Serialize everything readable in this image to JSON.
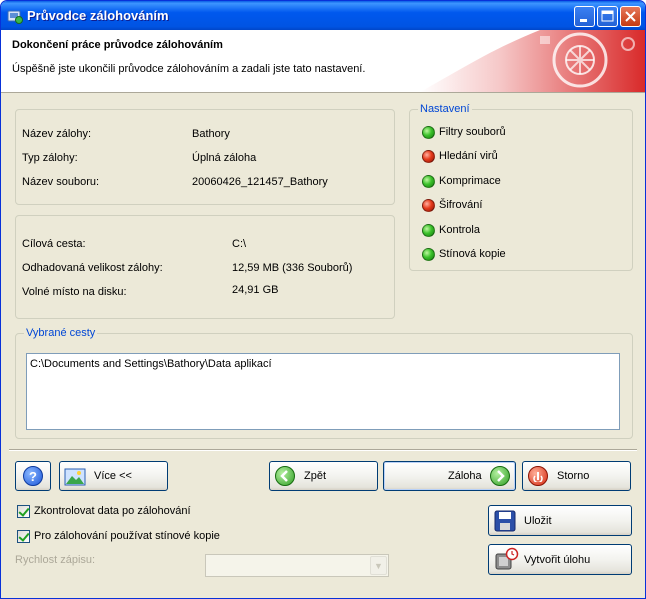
{
  "window": {
    "title": "Průvodce zálohováním"
  },
  "header": {
    "title": "Dokončení práce průvodce zálohováním",
    "subtitle": "Úspěšně jste ukončili průvodce zálohováním a zadali jste tato nastavení."
  },
  "summary": {
    "backup_name_label": "Název zálohy:",
    "backup_name_value": "Bathory",
    "backup_type_label": "Typ zálohy:",
    "backup_type_value": "Úplná záloha",
    "file_name_label": "Název souboru:",
    "file_name_value": "20060426_121457_Bathory"
  },
  "target": {
    "path_label": "Cílová cesta:",
    "path_value": "C:\\",
    "size_label": "Odhadovaná velikost zálohy:",
    "size_value": "12,59 MB (336 Souborů)",
    "free_label": "Volné místo na disku:",
    "free_value": "24,91 GB"
  },
  "settings": {
    "legend": "Nastavení",
    "items": [
      {
        "label": "Filtry souborů",
        "status": "green"
      },
      {
        "label": "Hledání virů",
        "status": "red"
      },
      {
        "label": "Komprimace",
        "status": "green"
      },
      {
        "label": "Šifrování",
        "status": "red"
      },
      {
        "label": "Kontrola",
        "status": "green"
      },
      {
        "label": "Stínová kopie",
        "status": "green"
      }
    ]
  },
  "paths": {
    "legend": "Vybrané cesty",
    "items": [
      "C:\\Documents and Settings\\Bathory\\Data aplikací"
    ]
  },
  "buttons": {
    "help_icon": "?",
    "more": "Více <<",
    "back": "Zpět",
    "backup": "Záloha",
    "cancel": "Storno",
    "save": "Uložit",
    "create_task": "Vytvořit úlohu"
  },
  "options": {
    "verify_label": "Zkontrolovat data po zálohování",
    "verify_checked": true,
    "shadow_label": "Pro zálohování používat stínové kopie",
    "shadow_checked": true,
    "speed_label": "Rychlost zápisu:",
    "speed_value": ""
  },
  "colors": {
    "titlebar": "#0054e3",
    "legend": "#0046d5",
    "ok": "#3cc22b",
    "error": "#e63b1c"
  }
}
